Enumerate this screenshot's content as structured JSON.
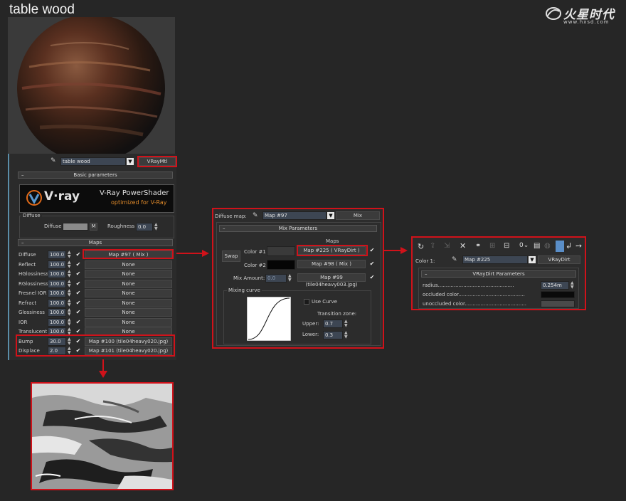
{
  "material_title": "table wood",
  "logo": {
    "cn": "火星时代",
    "url": "www.hxsd.com"
  },
  "material_editor": {
    "material_name": "table wood",
    "material_type_button": "VRayMtl",
    "basic_rollout": "Basic parameters",
    "vray_brand": "V·ray",
    "vray_tagline1": "V-Ray PowerShader",
    "vray_tagline2": "optimized for V-Ray",
    "diffuse_group": "Diffuse",
    "diffuse_label": "Diffuse",
    "diffuse_m_button": "M",
    "roughness_label": "Roughness",
    "roughness_value": "0.0",
    "maps_rollout": "Maps",
    "maps": [
      {
        "label": "Diffuse",
        "amount": "100.0",
        "map": "Map #97  ( Mix )"
      },
      {
        "label": "Reflect",
        "amount": "100.0",
        "map": "None"
      },
      {
        "label": "HGlossiness",
        "amount": "100.0",
        "map": "None"
      },
      {
        "label": "RGlossiness",
        "amount": "100.0",
        "map": "None"
      },
      {
        "label": "Fresnel IOR",
        "amount": "100.0",
        "map": "None"
      },
      {
        "label": "Refract",
        "amount": "100.0",
        "map": "None"
      },
      {
        "label": "Glossiness",
        "amount": "100.0",
        "map": "None"
      },
      {
        "label": "IOR",
        "amount": "100.0",
        "map": "None"
      },
      {
        "label": "Translucent",
        "amount": "100.0",
        "map": "None"
      },
      {
        "label": "Bump",
        "amount": "30.0",
        "map": "Map #100 (tile04heavy020.jpg)"
      },
      {
        "label": "Displace",
        "amount": "2.0",
        "map": "Map #101 (tile04heavy020.jpg)"
      }
    ]
  },
  "mix_panel": {
    "slot_label": "Diffuse map:",
    "map_name": "Map #97",
    "type_button": "Mix",
    "rollout": "Mix Parameters",
    "maps_header": "Maps",
    "swap_button": "Swap",
    "color1_label": "Color #1",
    "color1_map": "Map #225  ( VRayDirt )",
    "color2_label": "Color #2",
    "color2_map": "Map #98  ( Mix )",
    "mix_amount_label": "Mix Amount:",
    "mix_amount_value": "0.0",
    "mix_amount_map": "Map #99 (tile04heavy003.jpg)",
    "mixing_curve_group": "Mixing curve",
    "use_curve_label": "Use Curve",
    "transition_zone_label": "Transition zone:",
    "upper_label": "Upper:",
    "upper_value": "0.7",
    "lower_label": "Lower:",
    "lower_value": "0.3"
  },
  "dirt_panel": {
    "color_label": "Color 1:",
    "map_name": "Map #225",
    "type_button": "VRayDirt",
    "rollout": "VRayDirt Parameters",
    "radius_label": "radius................................................",
    "radius_value": "0.254m",
    "occluded_label": "occluded color..........................................",
    "unoccluded_label": "unoccluded color......................................."
  },
  "colors": {
    "highlight": "#d0121a",
    "field": "#3d4653",
    "panel": "#2c2c2c"
  }
}
